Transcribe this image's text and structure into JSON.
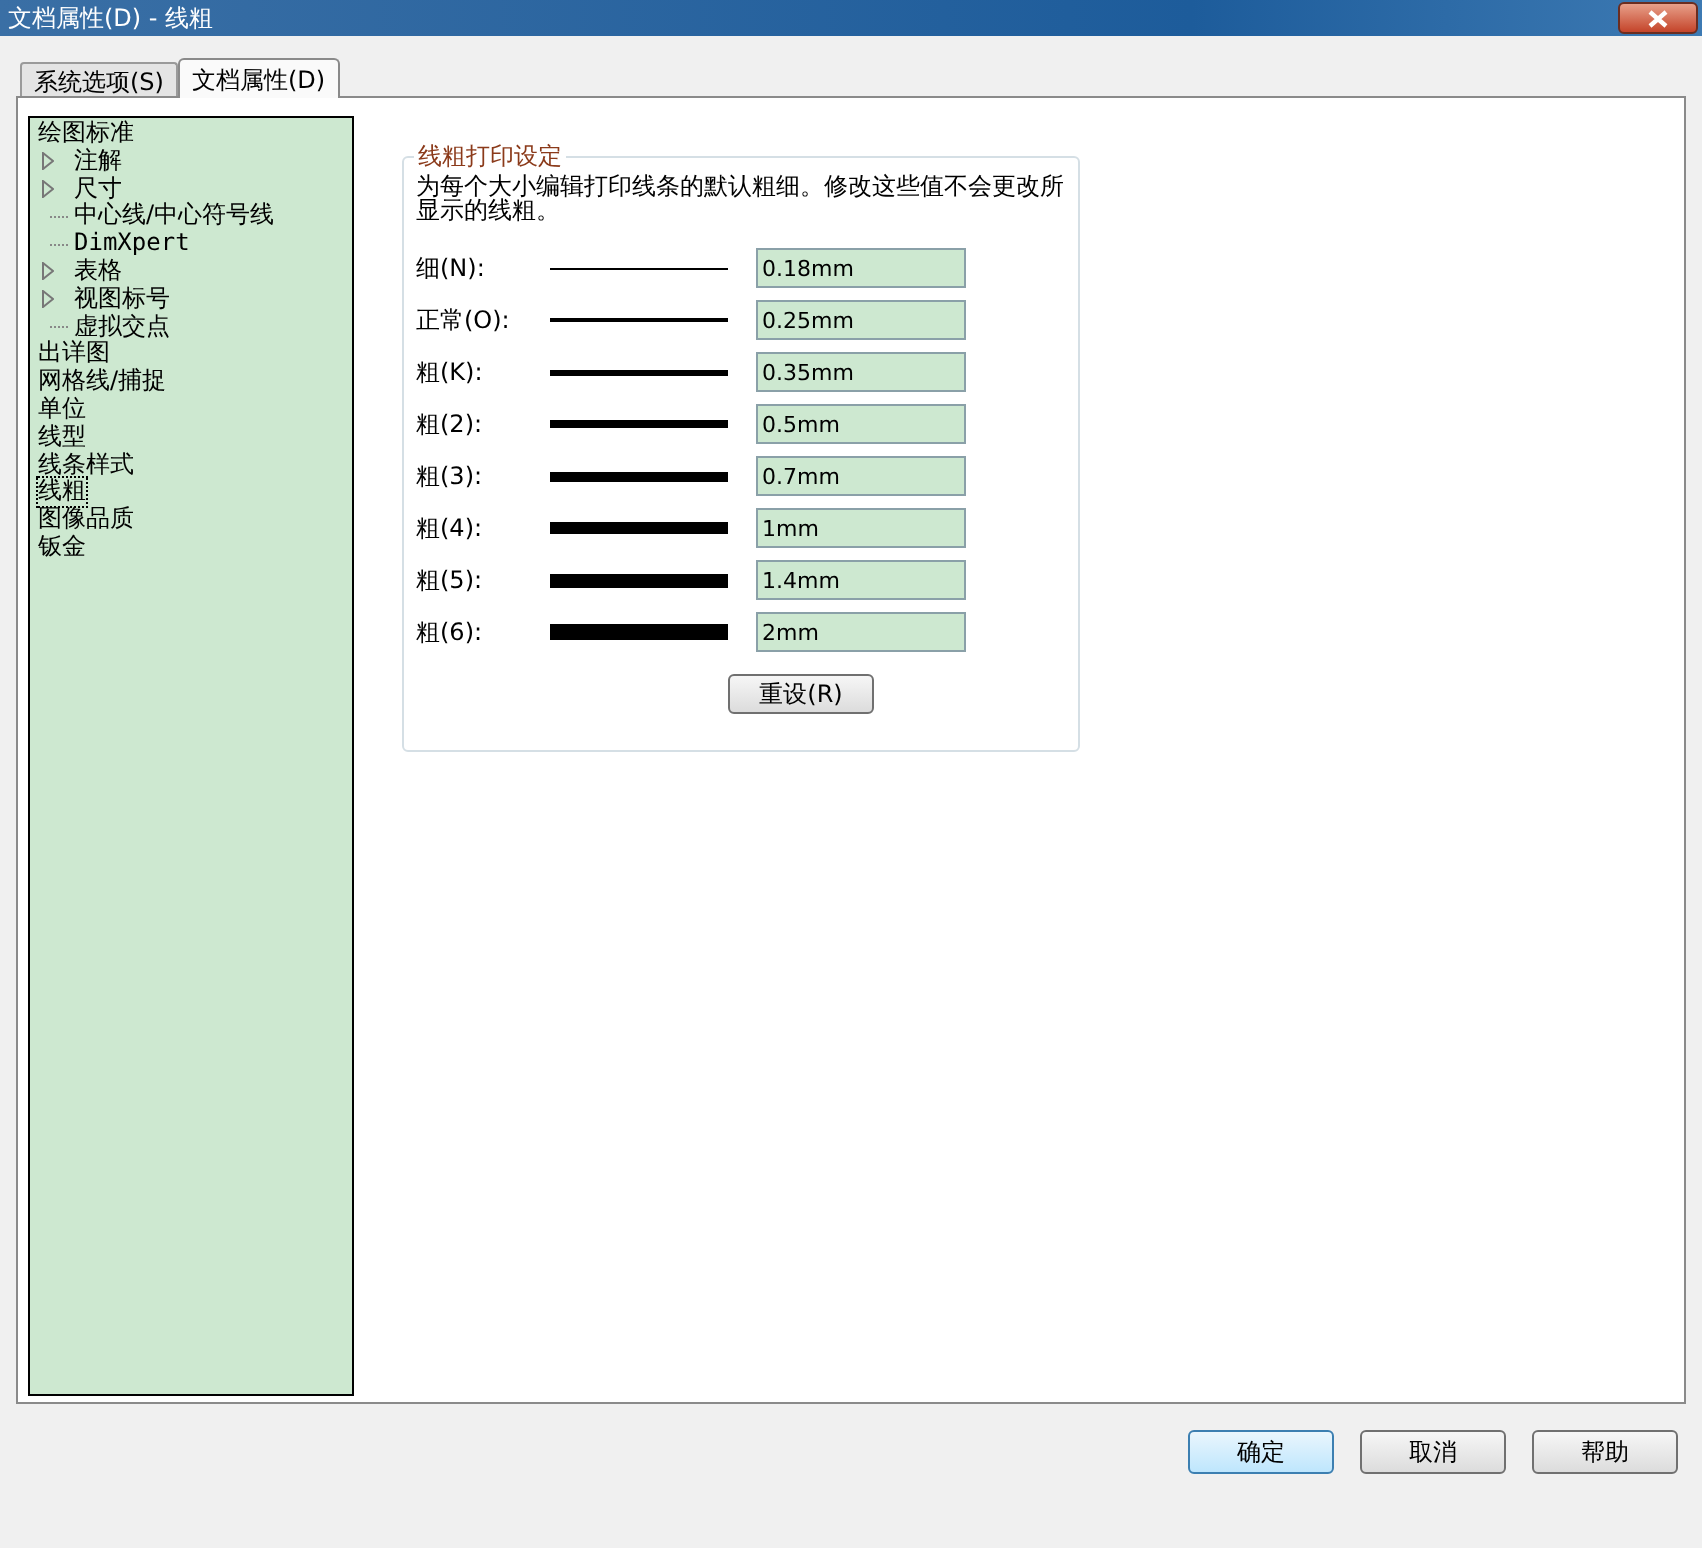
{
  "window": {
    "title": "文档属性(D) - 线粗"
  },
  "tabs": [
    {
      "label": "系统选项(S)",
      "selected": false
    },
    {
      "label": "文档属性(D)",
      "selected": true
    }
  ],
  "tree": [
    {
      "label": "绘图标准",
      "selected": false,
      "children": [
        {
          "label": "注解",
          "expandable": true,
          "selected": false
        },
        {
          "label": "尺寸",
          "expandable": true,
          "selected": false
        },
        {
          "label": "中心线/中心符号线",
          "expandable": false,
          "selected": false
        },
        {
          "label": "DimXpert",
          "expandable": false,
          "selected": false
        },
        {
          "label": "表格",
          "expandable": true,
          "selected": false
        },
        {
          "label": "视图标号",
          "expandable": true,
          "selected": false
        },
        {
          "label": "虚拟交点",
          "expandable": false,
          "selected": false
        }
      ]
    },
    {
      "label": "出详图",
      "selected": false
    },
    {
      "label": "网格线/捕捉",
      "selected": false
    },
    {
      "label": "单位",
      "selected": false
    },
    {
      "label": "线型",
      "selected": false
    },
    {
      "label": "线条样式",
      "selected": false
    },
    {
      "label": "线粗",
      "selected": true
    },
    {
      "label": "图像品质",
      "selected": false
    },
    {
      "label": "钣金",
      "selected": false
    }
  ],
  "group": {
    "title": "线粗打印设定",
    "description": "为每个大小编辑打印线条的默认粗细。修改这些值不会更改所显示的线粗。",
    "rows": [
      {
        "label": "细(N):",
        "value": "0.18mm"
      },
      {
        "label": "正常(O):",
        "value": "0.25mm"
      },
      {
        "label": "粗(K):",
        "value": "0.35mm"
      },
      {
        "label": "粗(2):",
        "value": "0.5mm"
      },
      {
        "label": "粗(3):",
        "value": "0.7mm"
      },
      {
        "label": "粗(4):",
        "value": "1mm"
      },
      {
        "label": "粗(5):",
        "value": "1.4mm"
      },
      {
        "label": "粗(6):",
        "value": "2mm"
      }
    ],
    "reset_button": "重设(R)"
  },
  "buttons": [
    {
      "label": "确定",
      "default": true
    },
    {
      "label": "取消",
      "default": false
    },
    {
      "label": "帮助",
      "default": false
    }
  ]
}
